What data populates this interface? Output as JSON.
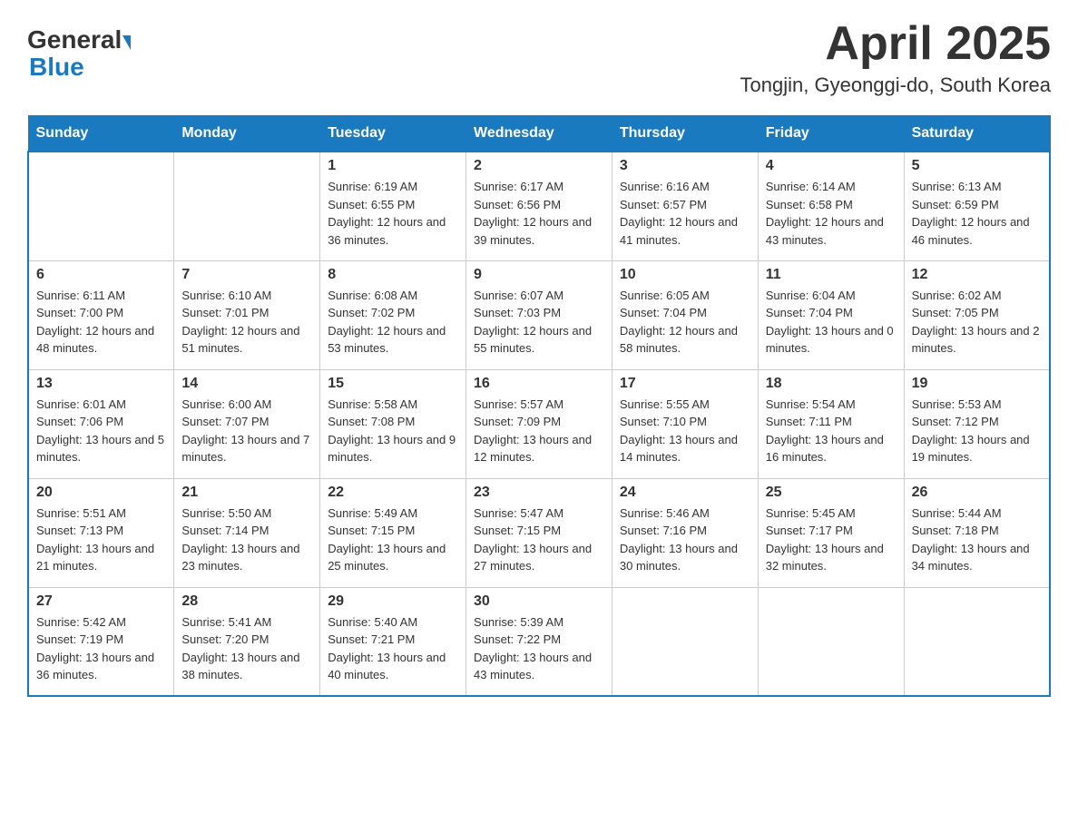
{
  "header": {
    "logo_general": "General",
    "logo_blue": "Blue",
    "title": "April 2025",
    "subtitle": "Tongjin, Gyeonggi-do, South Korea"
  },
  "days_of_week": [
    "Sunday",
    "Monday",
    "Tuesday",
    "Wednesday",
    "Thursday",
    "Friday",
    "Saturday"
  ],
  "weeks": [
    [
      {
        "day": "",
        "sunrise": "",
        "sunset": "",
        "daylight": ""
      },
      {
        "day": "",
        "sunrise": "",
        "sunset": "",
        "daylight": ""
      },
      {
        "day": "1",
        "sunrise": "Sunrise: 6:19 AM",
        "sunset": "Sunset: 6:55 PM",
        "daylight": "Daylight: 12 hours and 36 minutes."
      },
      {
        "day": "2",
        "sunrise": "Sunrise: 6:17 AM",
        "sunset": "Sunset: 6:56 PM",
        "daylight": "Daylight: 12 hours and 39 minutes."
      },
      {
        "day": "3",
        "sunrise": "Sunrise: 6:16 AM",
        "sunset": "Sunset: 6:57 PM",
        "daylight": "Daylight: 12 hours and 41 minutes."
      },
      {
        "day": "4",
        "sunrise": "Sunrise: 6:14 AM",
        "sunset": "Sunset: 6:58 PM",
        "daylight": "Daylight: 12 hours and 43 minutes."
      },
      {
        "day": "5",
        "sunrise": "Sunrise: 6:13 AM",
        "sunset": "Sunset: 6:59 PM",
        "daylight": "Daylight: 12 hours and 46 minutes."
      }
    ],
    [
      {
        "day": "6",
        "sunrise": "Sunrise: 6:11 AM",
        "sunset": "Sunset: 7:00 PM",
        "daylight": "Daylight: 12 hours and 48 minutes."
      },
      {
        "day": "7",
        "sunrise": "Sunrise: 6:10 AM",
        "sunset": "Sunset: 7:01 PM",
        "daylight": "Daylight: 12 hours and 51 minutes."
      },
      {
        "day": "8",
        "sunrise": "Sunrise: 6:08 AM",
        "sunset": "Sunset: 7:02 PM",
        "daylight": "Daylight: 12 hours and 53 minutes."
      },
      {
        "day": "9",
        "sunrise": "Sunrise: 6:07 AM",
        "sunset": "Sunset: 7:03 PM",
        "daylight": "Daylight: 12 hours and 55 minutes."
      },
      {
        "day": "10",
        "sunrise": "Sunrise: 6:05 AM",
        "sunset": "Sunset: 7:04 PM",
        "daylight": "Daylight: 12 hours and 58 minutes."
      },
      {
        "day": "11",
        "sunrise": "Sunrise: 6:04 AM",
        "sunset": "Sunset: 7:04 PM",
        "daylight": "Daylight: 13 hours and 0 minutes."
      },
      {
        "day": "12",
        "sunrise": "Sunrise: 6:02 AM",
        "sunset": "Sunset: 7:05 PM",
        "daylight": "Daylight: 13 hours and 2 minutes."
      }
    ],
    [
      {
        "day": "13",
        "sunrise": "Sunrise: 6:01 AM",
        "sunset": "Sunset: 7:06 PM",
        "daylight": "Daylight: 13 hours and 5 minutes."
      },
      {
        "day": "14",
        "sunrise": "Sunrise: 6:00 AM",
        "sunset": "Sunset: 7:07 PM",
        "daylight": "Daylight: 13 hours and 7 minutes."
      },
      {
        "day": "15",
        "sunrise": "Sunrise: 5:58 AM",
        "sunset": "Sunset: 7:08 PM",
        "daylight": "Daylight: 13 hours and 9 minutes."
      },
      {
        "day": "16",
        "sunrise": "Sunrise: 5:57 AM",
        "sunset": "Sunset: 7:09 PM",
        "daylight": "Daylight: 13 hours and 12 minutes."
      },
      {
        "day": "17",
        "sunrise": "Sunrise: 5:55 AM",
        "sunset": "Sunset: 7:10 PM",
        "daylight": "Daylight: 13 hours and 14 minutes."
      },
      {
        "day": "18",
        "sunrise": "Sunrise: 5:54 AM",
        "sunset": "Sunset: 7:11 PM",
        "daylight": "Daylight: 13 hours and 16 minutes."
      },
      {
        "day": "19",
        "sunrise": "Sunrise: 5:53 AM",
        "sunset": "Sunset: 7:12 PM",
        "daylight": "Daylight: 13 hours and 19 minutes."
      }
    ],
    [
      {
        "day": "20",
        "sunrise": "Sunrise: 5:51 AM",
        "sunset": "Sunset: 7:13 PM",
        "daylight": "Daylight: 13 hours and 21 minutes."
      },
      {
        "day": "21",
        "sunrise": "Sunrise: 5:50 AM",
        "sunset": "Sunset: 7:14 PM",
        "daylight": "Daylight: 13 hours and 23 minutes."
      },
      {
        "day": "22",
        "sunrise": "Sunrise: 5:49 AM",
        "sunset": "Sunset: 7:15 PM",
        "daylight": "Daylight: 13 hours and 25 minutes."
      },
      {
        "day": "23",
        "sunrise": "Sunrise: 5:47 AM",
        "sunset": "Sunset: 7:15 PM",
        "daylight": "Daylight: 13 hours and 27 minutes."
      },
      {
        "day": "24",
        "sunrise": "Sunrise: 5:46 AM",
        "sunset": "Sunset: 7:16 PM",
        "daylight": "Daylight: 13 hours and 30 minutes."
      },
      {
        "day": "25",
        "sunrise": "Sunrise: 5:45 AM",
        "sunset": "Sunset: 7:17 PM",
        "daylight": "Daylight: 13 hours and 32 minutes."
      },
      {
        "day": "26",
        "sunrise": "Sunrise: 5:44 AM",
        "sunset": "Sunset: 7:18 PM",
        "daylight": "Daylight: 13 hours and 34 minutes."
      }
    ],
    [
      {
        "day": "27",
        "sunrise": "Sunrise: 5:42 AM",
        "sunset": "Sunset: 7:19 PM",
        "daylight": "Daylight: 13 hours and 36 minutes."
      },
      {
        "day": "28",
        "sunrise": "Sunrise: 5:41 AM",
        "sunset": "Sunset: 7:20 PM",
        "daylight": "Daylight: 13 hours and 38 minutes."
      },
      {
        "day": "29",
        "sunrise": "Sunrise: 5:40 AM",
        "sunset": "Sunset: 7:21 PM",
        "daylight": "Daylight: 13 hours and 40 minutes."
      },
      {
        "day": "30",
        "sunrise": "Sunrise: 5:39 AM",
        "sunset": "Sunset: 7:22 PM",
        "daylight": "Daylight: 13 hours and 43 minutes."
      },
      {
        "day": "",
        "sunrise": "",
        "sunset": "",
        "daylight": ""
      },
      {
        "day": "",
        "sunrise": "",
        "sunset": "",
        "daylight": ""
      },
      {
        "day": "",
        "sunrise": "",
        "sunset": "",
        "daylight": ""
      }
    ]
  ]
}
